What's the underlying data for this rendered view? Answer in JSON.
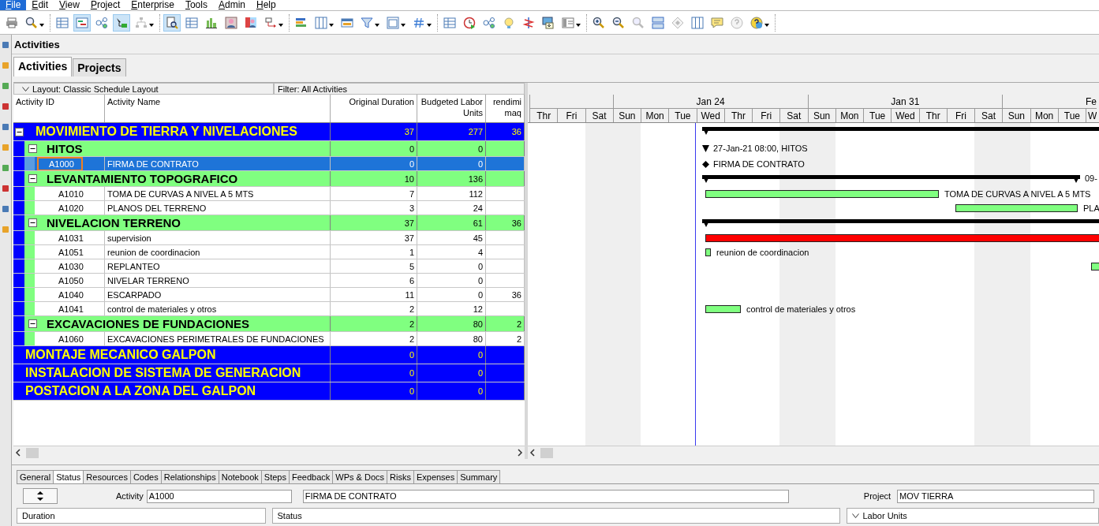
{
  "menu": [
    {
      "label": "File",
      "selected": true
    },
    {
      "label": "Edit",
      "selected": false
    },
    {
      "label": "View",
      "selected": false
    },
    {
      "label": "Project",
      "selected": false
    },
    {
      "label": "Enterprise",
      "selected": false
    },
    {
      "label": "Tools",
      "selected": false
    },
    {
      "label": "Admin",
      "selected": false
    },
    {
      "label": "Help",
      "selected": false
    }
  ],
  "toolbar": [
    [
      {
        "kind": "printer",
        "selected": false,
        "disabled": false,
        "dropdown": false
      },
      {
        "kind": "magnifier",
        "selected": false,
        "disabled": false,
        "dropdown": true
      }
    ],
    [
      {
        "kind": "table",
        "selected": false,
        "disabled": false,
        "dropdown": false
      },
      {
        "kind": "gantt",
        "selected": true,
        "disabled": false,
        "dropdown": false
      },
      {
        "kind": "flow",
        "selected": false,
        "disabled": false,
        "dropdown": false
      },
      {
        "kind": "arrows",
        "selected": true,
        "disabled": false,
        "dropdown": false
      },
      {
        "kind": "tree",
        "selected": false,
        "disabled": true,
        "dropdown": true
      }
    ],
    [
      {
        "kind": "document",
        "selected": true,
        "disabled": false,
        "dropdown": false
      },
      {
        "kind": "table",
        "selected": false,
        "disabled": false,
        "dropdown": false
      },
      {
        "kind": "bar-chart",
        "selected": false,
        "disabled": false,
        "dropdown": false
      },
      {
        "kind": "person",
        "selected": false,
        "disabled": false,
        "dropdown": false
      },
      {
        "kind": "people",
        "selected": false,
        "disabled": false,
        "dropdown": false
      },
      {
        "kind": "connector",
        "selected": false,
        "disabled": false,
        "dropdown": true
      }
    ],
    [
      {
        "kind": "bars",
        "selected": false,
        "disabled": false,
        "dropdown": false
      },
      {
        "kind": "columns",
        "selected": false,
        "disabled": false,
        "dropdown": true
      },
      {
        "kind": "calendar",
        "selected": false,
        "disabled": false,
        "dropdown": false
      },
      {
        "kind": "filter",
        "selected": false,
        "disabled": false,
        "dropdown": true
      },
      {
        "kind": "layout",
        "selected": false,
        "disabled": false,
        "dropdown": true
      },
      {
        "kind": "hash",
        "selected": false,
        "disabled": false,
        "dropdown": true
      }
    ],
    [
      {
        "kind": "table",
        "selected": false,
        "disabled": false,
        "dropdown": false
      },
      {
        "kind": "clock",
        "selected": false,
        "disabled": false,
        "dropdown": false
      },
      {
        "kind": "nodes",
        "selected": false,
        "disabled": false,
        "dropdown": false
      },
      {
        "kind": "bulb",
        "selected": false,
        "disabled": false,
        "dropdown": false
      },
      {
        "kind": "zigzag",
        "selected": false,
        "disabled": false,
        "dropdown": false
      },
      {
        "kind": "monitor",
        "selected": false,
        "disabled": false,
        "dropdown": false
      },
      {
        "kind": "panel",
        "selected": false,
        "disabled": false,
        "dropdown": true
      }
    ],
    [
      {
        "kind": "zoom-in",
        "selected": false,
        "disabled": false,
        "dropdown": false
      },
      {
        "kind": "zoom-out",
        "selected": false,
        "disabled": false,
        "dropdown": false
      },
      {
        "kind": "magnifier",
        "selected": false,
        "disabled": true,
        "dropdown": false
      },
      {
        "kind": "rows",
        "selected": false,
        "disabled": false,
        "dropdown": false
      },
      {
        "kind": "diamond",
        "selected": false,
        "disabled": true,
        "dropdown": false
      },
      {
        "kind": "columns",
        "selected": false,
        "disabled": false,
        "dropdown": false
      },
      {
        "kind": "speech-bubble",
        "selected": false,
        "disabled": false,
        "dropdown": false
      },
      {
        "kind": "question",
        "selected": false,
        "disabled": true,
        "dropdown": false
      },
      {
        "kind": "globe",
        "selected": false,
        "disabled": false,
        "dropdown": true
      }
    ]
  ],
  "page_title": "Activities",
  "view_tabs": [
    {
      "label": "Activities",
      "selected": true
    },
    {
      "label": "Projects",
      "selected": false
    }
  ],
  "layout_bar": {
    "layout": "Layout: Classic Schedule Layout",
    "filter": "Filter: All Activities"
  },
  "table": {
    "columns": [
      "Activity ID",
      "Activity Name",
      "Original Duration",
      "Budgeted Labor Units",
      "rendimi maq"
    ],
    "rows": [
      {
        "kind": "wbs",
        "name": "MOVIMIENTO DE TIERRA Y NIVELACIONES",
        "duration": "37",
        "units": "277",
        "column_5": "36",
        "expanded": true,
        "bar": {
          "kind": "summary"
        },
        "children": [
          {
            "kind": "wbs",
            "name": "HITOS",
            "duration": "0",
            "units": "0",
            "expanded": true,
            "bar": {
              "kind": "flag",
              "label": "27-Jan-21 08:00, HITOS"
            },
            "children": [
              {
                "kind": "activity",
                "id": "A1000",
                "name": "FIRMA DE CONTRATO",
                "duration": "0",
                "units": "0",
                "selected": true,
                "bar": {
                  "kind": "milestone",
                  "label": "FIRMA DE CONTRATO"
                }
              }
            ]
          },
          {
            "kind": "wbs",
            "name": "LEVANTAMIENTO TOPOGRAFICO",
            "duration": "10",
            "units": "136",
            "expanded": true,
            "bar": {
              "kind": "summary",
              "label": "09-"
            },
            "children": [
              {
                "kind": "activity",
                "id": "A1010",
                "name": "TOMA DE CURVAS A NIVEL A 5 MTS",
                "duration": "7",
                "units": "112",
                "selected": false,
                "bar": {
                  "kind": "task",
                  "label": "TOMA DE CURVAS A NIVEL A 5 MTS"
                }
              },
              {
                "kind": "activity",
                "id": "A1020",
                "name": "PLANOS DEL TERRENO",
                "duration": "3",
                "units": "24",
                "selected": false,
                "bar": {
                  "kind": "task",
                  "label": "PLA"
                }
              }
            ]
          },
          {
            "kind": "wbs",
            "name": "NIVELACION TERRENO",
            "duration": "37",
            "units": "61",
            "column_5": "36",
            "expanded": true,
            "bar": {
              "kind": "summary"
            },
            "children": [
              {
                "kind": "activity",
                "id": "A1031",
                "name": "supervision",
                "duration": "37",
                "units": "45",
                "selected": false,
                "bar": {
                  "kind": "critical"
                }
              },
              {
                "kind": "activity",
                "id": "A1051",
                "name": "reunion de coordinacion",
                "duration": "1",
                "units": "4",
                "selected": false,
                "bar": {
                  "kind": "task",
                  "label": "reunion de coordinacion"
                }
              },
              {
                "kind": "activity",
                "id": "A1030",
                "name": "REPLANTEO",
                "duration": "5",
                "units": "0",
                "selected": false,
                "bar": {
                  "kind": "task"
                }
              },
              {
                "kind": "activity",
                "id": "A1050",
                "name": "NIVELAR TERRENO",
                "duration": "6",
                "units": "0",
                "selected": false
              },
              {
                "kind": "activity",
                "id": "A1040",
                "name": "ESCARPADO",
                "duration": "11",
                "units": "0",
                "column_5": "36",
                "selected": false
              },
              {
                "kind": "activity",
                "id": "A1041",
                "name": "control de materiales y otros",
                "duration": "2",
                "units": "12",
                "selected": false,
                "bar": {
                  "kind": "task",
                  "label": "control de materiales y otros"
                }
              }
            ]
          },
          {
            "kind": "wbs",
            "name": "EXCAVACIONES DE FUNDACIONES",
            "duration": "2",
            "units": "80",
            "column_5": "2",
            "expanded": true,
            "children": [
              {
                "kind": "activity",
                "id": "A1060",
                "name": "EXCAVACIONES PERIMETRALES DE FUNDACIONES",
                "duration": "2",
                "units": "80",
                "column_5": "2",
                "selected": false
              }
            ]
          }
        ]
      },
      {
        "kind": "wbs",
        "name": "MONTAJE MECANICO GALPON",
        "duration": "0",
        "units": "0"
      },
      {
        "kind": "wbs",
        "name": "INSTALACION DE SISTEMA DE GENERACION",
        "duration": "0",
        "units": "0"
      },
      {
        "kind": "wbs",
        "name": "POSTACION A LA ZONA DEL GALPON",
        "duration": "0",
        "units": "0"
      }
    ]
  },
  "gantt": {
    "weeks": [
      {
        "days": [
          {
            "label": "Thr",
            "nonwork": false
          },
          {
            "label": "Fri",
            "nonwork": false
          },
          {
            "label": "Sat",
            "nonwork": true
          }
        ]
      },
      {
        "label": "Jan 24",
        "days": [
          {
            "label": "Sun",
            "nonwork": true
          },
          {
            "label": "Mon",
            "nonwork": false
          },
          {
            "label": "Tue",
            "nonwork": false
          },
          {
            "label": "Wed",
            "nonwork": false
          },
          {
            "label": "Thr",
            "nonwork": false
          },
          {
            "label": "Fri",
            "nonwork": false
          },
          {
            "label": "Sat",
            "nonwork": true
          }
        ]
      },
      {
        "label": "Jan 31",
        "days": [
          {
            "label": "Sun",
            "nonwork": true
          },
          {
            "label": "Mon",
            "nonwork": false
          },
          {
            "label": "Tue",
            "nonwork": false
          },
          {
            "label": "Wed",
            "nonwork": false
          },
          {
            "label": "Thr",
            "nonwork": false
          },
          {
            "label": "Fri",
            "nonwork": false
          },
          {
            "label": "Sat",
            "nonwork": true
          }
        ]
      },
      {
        "label": "Fe",
        "days": [
          {
            "label": "Sun",
            "nonwork": true
          },
          {
            "label": "Mon",
            "nonwork": false
          },
          {
            "label": "Tue",
            "nonwork": false
          },
          {
            "label": "W",
            "nonwork": false
          }
        ]
      }
    ]
  },
  "bottom_panel": {
    "tabs": [
      {
        "label": "General",
        "selected": false
      },
      {
        "label": "Status",
        "selected": true
      },
      {
        "label": "Resources",
        "selected": false
      },
      {
        "label": "Codes",
        "selected": false
      },
      {
        "label": "Relationships",
        "selected": false
      },
      {
        "label": "Notebook",
        "selected": false
      },
      {
        "label": "Steps",
        "selected": false
      },
      {
        "label": "Feedback",
        "selected": false
      },
      {
        "label": "WPs & Docs",
        "selected": false
      },
      {
        "label": "Risks",
        "selected": false
      },
      {
        "label": "Expenses",
        "selected": false
      },
      {
        "label": "Summary",
        "selected": false
      }
    ],
    "activity_label": "Activity",
    "activity_id": "A1000",
    "activity_name": "FIRMA DE CONTRATO",
    "project_label": "Project",
    "project": "MOV TIERRA",
    "sections": [
      {
        "label": "Duration",
        "collapsible": false
      },
      {
        "label": "Status",
        "collapsible": false
      },
      {
        "label": "Labor Units",
        "collapsible": true
      }
    ]
  }
}
